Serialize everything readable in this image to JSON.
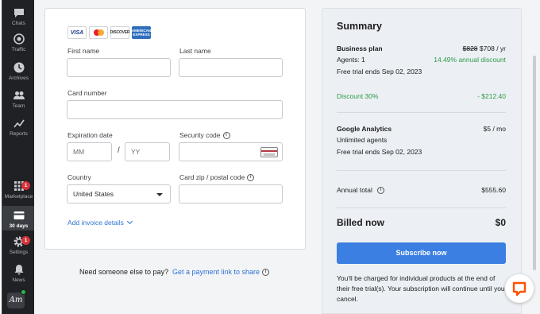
{
  "sidebar": {
    "items": [
      {
        "label": "Chats",
        "icon": "chat-icon"
      },
      {
        "label": "Traffic",
        "icon": "traffic-icon"
      },
      {
        "label": "Archives",
        "icon": "clock-icon"
      },
      {
        "label": "Team",
        "icon": "team-icon"
      },
      {
        "label": "Reports",
        "icon": "chart-icon"
      },
      {
        "label": "Marketplace",
        "icon": "grid-icon",
        "badge": "1"
      },
      {
        "label": "30 days",
        "icon": "card-icon",
        "active": true
      },
      {
        "label": "Settings",
        "icon": "gear-icon",
        "badge": "1"
      },
      {
        "label": "News",
        "icon": "bell-icon"
      }
    ],
    "avatar_text": "Am"
  },
  "form": {
    "card_brands": [
      "VISA",
      "mastercard",
      "DISCOVER",
      "AMERICAN EXPRESS"
    ],
    "first_name_label": "First name",
    "last_name_label": "Last name",
    "card_number_label": "Card number",
    "expiration_label": "Expiration date",
    "month_placeholder": "MM",
    "year_placeholder": "YY",
    "slash": "/",
    "security_label": "Security code",
    "country_label": "Country",
    "country_value": "United States",
    "zip_label": "Card zip / postal code",
    "invoice_link": "Add invoice details"
  },
  "payment_link": {
    "prompt": "Need someone else to pay?",
    "link": "Get a payment link to share"
  },
  "summary": {
    "title": "Summary",
    "business": {
      "name": "Business plan",
      "old_price": "$828",
      "price": "$708 / yr",
      "agents": "Agents: 1",
      "discount_text": "14.49% annual discount",
      "trial": "Free trial ends Sep 02, 2023"
    },
    "discount": {
      "label": "Discount 30%",
      "amount": "- $212.40"
    },
    "analytics": {
      "name": "Google Analytics",
      "price": "$5 / mo",
      "agents": "Unlimited agents",
      "trial": "Free trial ends Sep 02, 2023"
    },
    "annual_total": {
      "label": "Annual total",
      "amount": "$555.60"
    },
    "billed_now": {
      "label": "Billed now",
      "amount": "$0"
    },
    "subscribe_label": "Subscribe now",
    "note": "You'll be charged for individual products at the end of their free trial(s). Your subscription will continue until you cancel."
  },
  "colors": {
    "accent": "#3b7fe3",
    "green": "#2e9a4a",
    "badge": "#d6323a",
    "chat_bubble": "#ff5100"
  }
}
